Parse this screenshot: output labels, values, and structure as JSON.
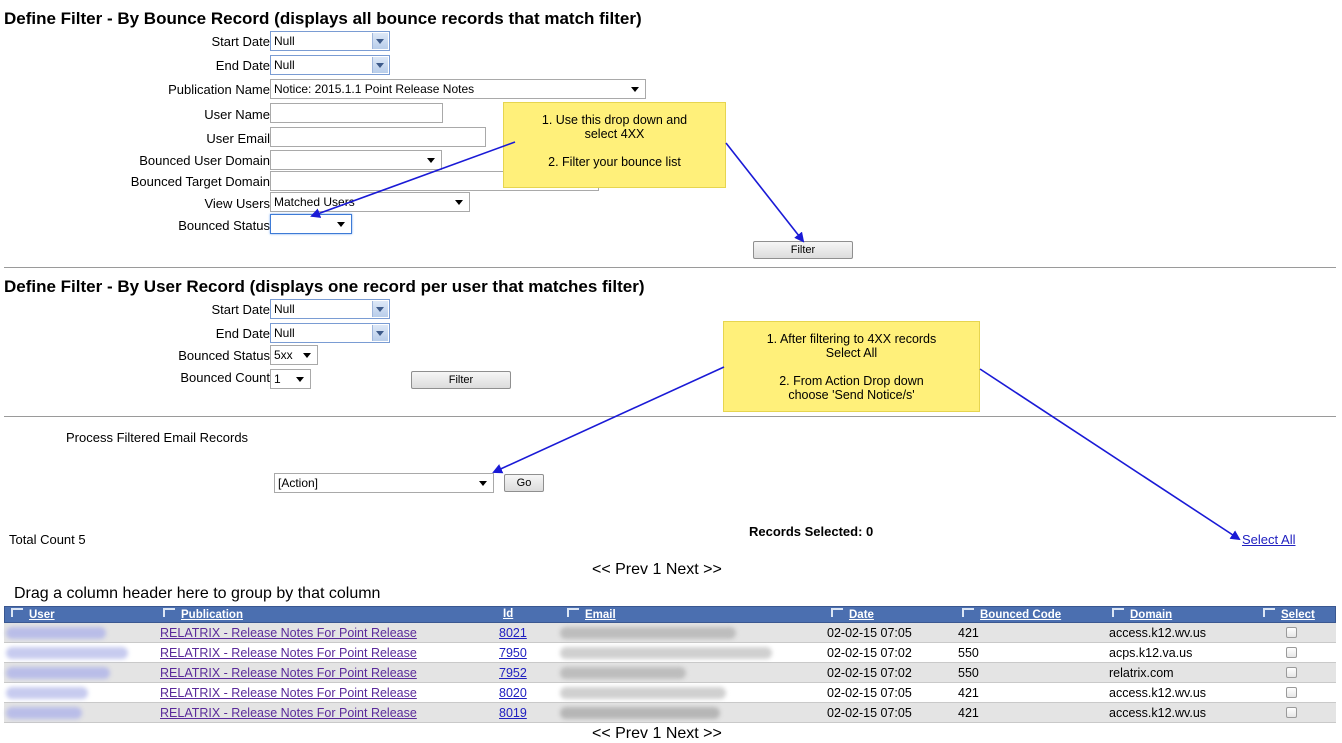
{
  "bounce_filter": {
    "title": "Define Filter - By Bounce Record (displays all bounce records that match filter)",
    "start_date_label": "Start Date",
    "start_date_value": "Null",
    "end_date_label": "End Date",
    "end_date_value": "Null",
    "publication_label": "Publication Name",
    "publication_value": "Notice: 2015.1.1 Point Release Notes",
    "user_name_label": "User Name",
    "user_email_label": "User Email",
    "bounced_user_domain_label": "Bounced User Domain",
    "bounced_target_domain_label": "Bounced Target Domain",
    "view_users_label": "View Users",
    "view_users_value": "Matched Users",
    "bounced_status_label": "Bounced Status",
    "bounced_status_value": "",
    "filter_button": "Filter"
  },
  "user_filter": {
    "title": "Define Filter - By User Record (displays one record per user that matches filter)",
    "start_date_label": "Start Date",
    "start_date_value": "Null",
    "end_date_label": "End Date",
    "end_date_value": "Null",
    "bounced_status_label": "Bounced Status",
    "bounced_status_value": "5xx",
    "bounced_count_label": "Bounced Count",
    "bounced_count_value": "1",
    "filter_button": "Filter"
  },
  "process": {
    "title": "Process Filtered Email Records",
    "action_value": "[Action]",
    "go_button": "Go"
  },
  "notes": {
    "note1_line1": "1. Use this drop down and select 4XX",
    "note1_line2": "2. Filter your bounce list",
    "note2_line1": "1. After filtering to 4XX records Select All",
    "note2_line2": "2. From Action Drop down choose 'Send Notice/s'"
  },
  "summary": {
    "total_count": "Total Count 5",
    "records_selected": "Records Selected: 0",
    "select_all": "Select All",
    "pager_top": "<< Prev 1 Next >>",
    "pager_bottom": "<< Prev 1 Next >>",
    "group_hint": "Drag a column header here to group by that column"
  },
  "grid": {
    "columns": [
      "User",
      "Publication",
      "Id",
      "Email",
      "Date",
      "Bounced Code",
      "Domain",
      "Select"
    ],
    "rows": [
      {
        "publication": "RELATRIX - Release Notes For Point Release",
        "id": "8021",
        "date": "02-02-15 07:05",
        "code": "421",
        "domain": "access.k12.wv.us"
      },
      {
        "publication": "RELATRIX - Release Notes For Point Release",
        "id": "7950",
        "date": "02-02-15 07:02",
        "code": "550",
        "domain": "acps.k12.va.us"
      },
      {
        "publication": "RELATRIX - Release Notes For Point Release",
        "id": "7952",
        "date": "02-02-15 07:02",
        "code": "550",
        "domain": "relatrix.com"
      },
      {
        "publication": "RELATRIX - Release Notes For Point Release",
        "id": "8020",
        "date": "02-02-15 07:05",
        "code": "421",
        "domain": "access.k12.wv.us"
      },
      {
        "publication": "RELATRIX - Release Notes For Point Release",
        "id": "8019",
        "date": "02-02-15 07:05",
        "code": "421",
        "domain": "access.k12.wv.us"
      }
    ]
  },
  "colors": {
    "note_bg": "#fff07a",
    "grid_header": "#4b6fb0",
    "arrow": "#1a1ad6"
  }
}
